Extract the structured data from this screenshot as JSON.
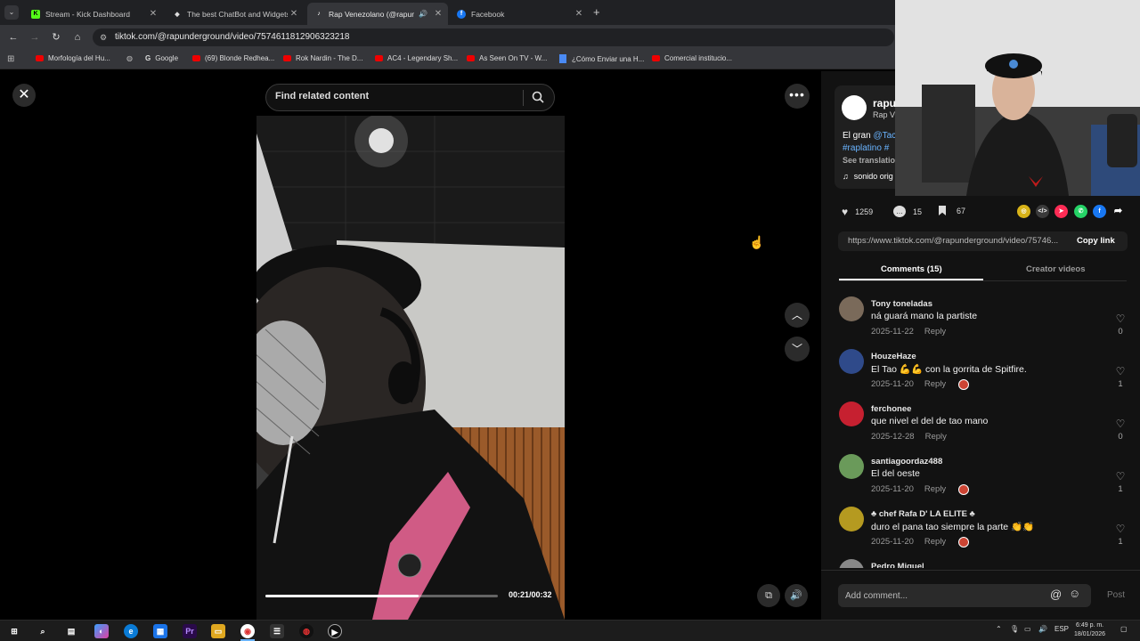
{
  "browser": {
    "tabs": [
      {
        "label": "Stream - Kick Dashboard",
        "icon": "kick-icon"
      },
      {
        "label": "The best ChatBot and Widgets",
        "icon": "widget-icon"
      },
      {
        "label": "Rap Venezolano (@rapunde",
        "icon": "tiktok-icon",
        "active": true
      },
      {
        "label": "Facebook",
        "icon": "facebook-icon"
      }
    ],
    "url": "tiktok.com/@rapunderground/video/7574611812906323218",
    "bookmarks": [
      "Morfología del Hu...",
      "Google",
      "(69) Blonde Redhea...",
      "Rok Nardin - The D...",
      "AC4 - Legendary Sh...",
      "As Seen On TV - W...",
      "¿Cómo Enviar una H...",
      "Comercial institucio..."
    ]
  },
  "video": {
    "search_placeholder": "Find related content",
    "time": "00:21/00:32",
    "progress": 0.66
  },
  "info": {
    "author_short": "rapu",
    "author_sub": "Rap V",
    "desc_line1_prefix": "El gran ",
    "desc_mention": "@Tac",
    "desc_tags": "#raplatino #",
    "see_translation": "See translatio",
    "sound": "sonido orig"
  },
  "stats": {
    "likes": "1259",
    "comments": "15",
    "saves": "67"
  },
  "link": {
    "url": "https://www.tiktok.com/@rapunderground/video/75746...",
    "copy_label": "Copy link"
  },
  "panel_tabs": {
    "comments": "Comments (15)",
    "creator": "Creator videos"
  },
  "comments": [
    {
      "name": "Tony toneladas",
      "text": "ná guará mano la partiste",
      "date": "2025-11-22",
      "reply": "Reply",
      "likes": "0",
      "author_liked": false,
      "avatar_color": "#7a6a5a"
    },
    {
      "name": "HouzeHaze",
      "text": "El Tao 💪💪 con la gorrita de Spitfire.",
      "date": "2025-11-20",
      "reply": "Reply",
      "likes": "1",
      "author_liked": true,
      "avatar_color": "#2f4a8a"
    },
    {
      "name": "ferchonee",
      "text": "que nivel el del de tao mano",
      "date": "2025-12-28",
      "reply": "Reply",
      "likes": "0",
      "author_liked": false,
      "avatar_color": "#c62030"
    },
    {
      "name": "santiagoordaz488",
      "text": "El del oeste",
      "date": "2025-11-20",
      "reply": "Reply",
      "likes": "1",
      "author_liked": true,
      "avatar_color": "#6a9a5a"
    },
    {
      "name": "♣ chef Rafa D' LA ELITE ♣",
      "text": "duro el pana tao siempre la parte 👏👏",
      "date": "2025-11-20",
      "reply": "Reply",
      "likes": "1",
      "author_liked": true,
      "avatar_color": "#b59a20"
    },
    {
      "name": "Pedro Miguel",
      "text": "",
      "date": "",
      "reply": "",
      "likes": "",
      "author_liked": false,
      "avatar_color": "#888"
    }
  ],
  "comment_bar": {
    "placeholder": "Add comment...",
    "post": "Post"
  },
  "taskbar": {
    "lang": "ESP",
    "time": "6:49 p. m.",
    "date": "18/01/2026"
  }
}
